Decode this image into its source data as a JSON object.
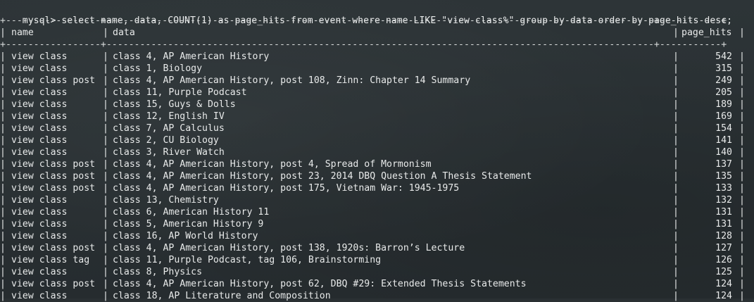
{
  "prompt": "mysql>",
  "command": "select name, data, COUNT(1) as page_hits from event where name LIKE \"view class%\" group by data order by page_hits desc;",
  "columns": [
    "name",
    "data",
    "page_hits"
  ],
  "rows": [
    {
      "name": "view class",
      "data": "class 4, AP American History",
      "page_hits": "542"
    },
    {
      "name": "view class",
      "data": "class 1, Biology",
      "page_hits": "315"
    },
    {
      "name": "view class post",
      "data": "class 4, AP American History, post 108, Zinn: Chapter 14 Summary",
      "page_hits": "249"
    },
    {
      "name": "view class",
      "data": "class 11, Purple Podcast",
      "page_hits": "205"
    },
    {
      "name": "view class",
      "data": "class 15, Guys & Dolls",
      "page_hits": "189"
    },
    {
      "name": "view class",
      "data": "class 12, English IV",
      "page_hits": "169"
    },
    {
      "name": "view class",
      "data": "class 7, AP Calculus",
      "page_hits": "154"
    },
    {
      "name": "view class",
      "data": "class 2, CU Biology",
      "page_hits": "141"
    },
    {
      "name": "view class",
      "data": "class 3, River Watch",
      "page_hits": "140"
    },
    {
      "name": "view class post",
      "data": "class 4, AP American History, post 4, Spread of Mormonism",
      "page_hits": "137"
    },
    {
      "name": "view class post",
      "data": "class 4, AP American History, post 23, 2014 DBQ Question A Thesis Statement",
      "page_hits": "135"
    },
    {
      "name": "view class post",
      "data": "class 4, AP American History, post 175, Vietnam War: 1945-1975",
      "page_hits": "133"
    },
    {
      "name": "view class",
      "data": "class 13, Chemistry",
      "page_hits": "132"
    },
    {
      "name": "view class",
      "data": "class 6, American History 11",
      "page_hits": "131"
    },
    {
      "name": "view class",
      "data": "class 5, American History 9",
      "page_hits": "131"
    },
    {
      "name": "view class",
      "data": "class 16, AP World History",
      "page_hits": "128"
    },
    {
      "name": "view class post",
      "data": "class 4, AP American History, post 138, 1920s: Barron’s Lecture",
      "page_hits": "127"
    },
    {
      "name": "view class tag",
      "data": "class 11, Purple Podcast, tag 106, Brainstorming",
      "page_hits": "126"
    },
    {
      "name": "view class",
      "data": "class 8, Physics",
      "page_hits": "125"
    },
    {
      "name": "view class post",
      "data": "class 4, AP American History, post 62, DBQ #29: Extended Thesis Statements",
      "page_hits": "124"
    },
    {
      "name": "view class",
      "data": "class 18, AP Literature and Composition",
      "page_hits": "124"
    }
  ]
}
